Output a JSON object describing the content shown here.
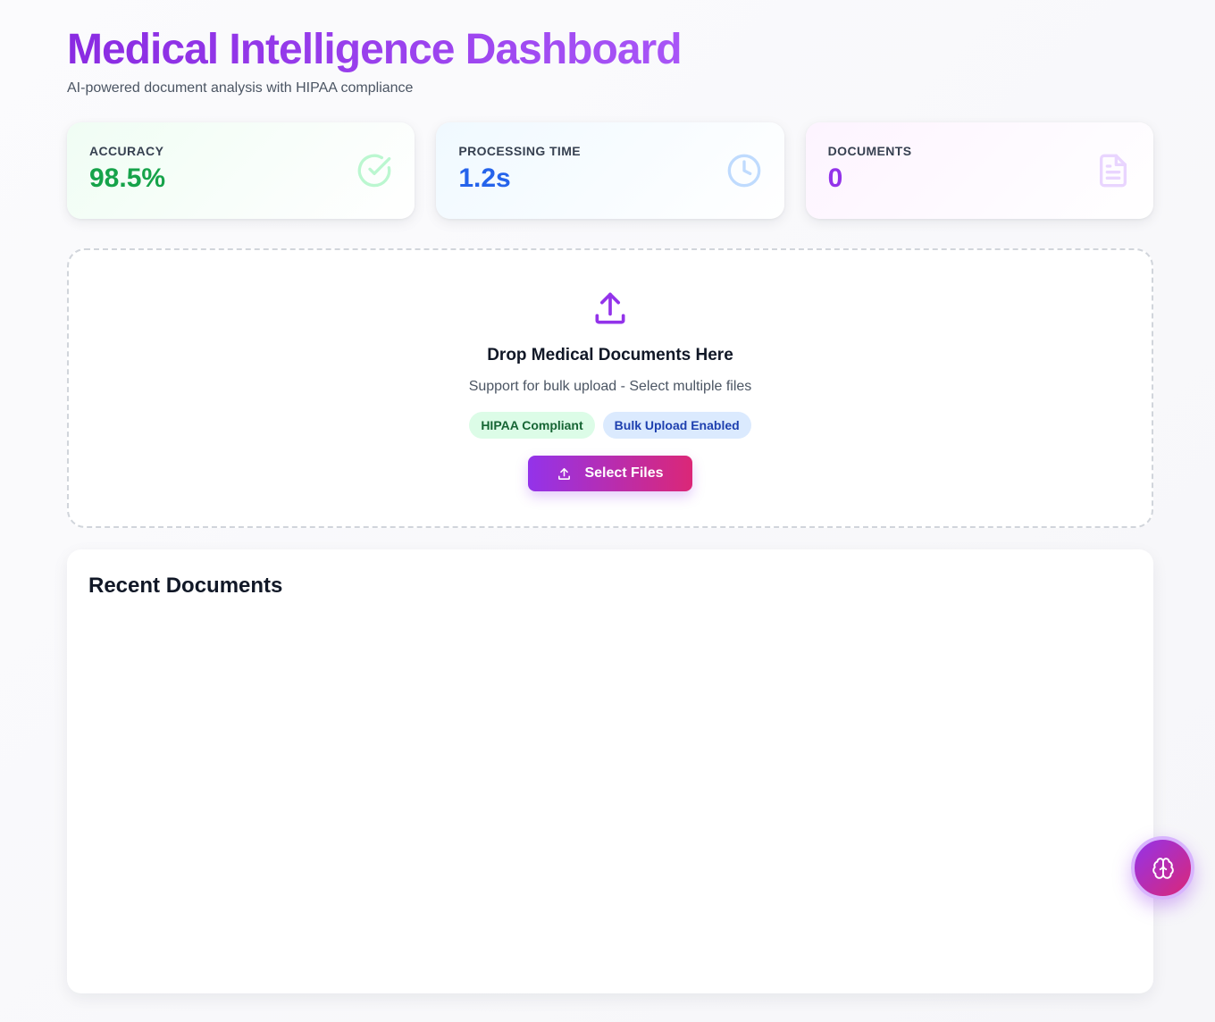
{
  "header": {
    "title": "Medical Intelligence Dashboard",
    "subtitle": "AI-powered document analysis with HIPAA compliance"
  },
  "stats": [
    {
      "label": "ACCURACY",
      "value": "98.5%",
      "icon": "check-circle-icon",
      "color": "#16a34a"
    },
    {
      "label": "PROCESSING TIME",
      "value": "1.2s",
      "icon": "clock-icon",
      "color": "#2563eb"
    },
    {
      "label": "DOCUMENTS",
      "value": "0",
      "icon": "document-icon",
      "color": "#9333ea"
    }
  ],
  "upload": {
    "title": "Drop Medical Documents Here",
    "subtitle": "Support for bulk upload - Select multiple files",
    "badges": [
      "HIPAA Compliant",
      "Bulk Upload Enabled"
    ],
    "button_label": "Select Files"
  },
  "recent": {
    "title": "Recent Documents"
  },
  "colors": {
    "accent_start": "#9333ea",
    "accent_end": "#db2777"
  },
  "fab": {
    "icon": "brain-icon"
  }
}
